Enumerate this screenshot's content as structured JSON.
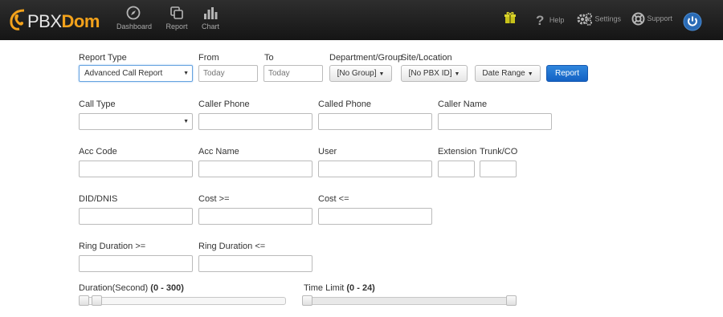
{
  "brand": {
    "logo_prefix": "PBX",
    "logo_suffix": "Dom",
    "accent": "#f3a21b"
  },
  "nav": {
    "items": [
      {
        "label": "Dashboard",
        "icon": "compass-icon"
      },
      {
        "label": "Report",
        "icon": "copy-icon"
      },
      {
        "label": "Chart",
        "icon": "bar-chart-icon"
      }
    ],
    "right": {
      "help": "Help",
      "settings": "Settings",
      "support": "Support"
    }
  },
  "form": {
    "report_type": {
      "label": "Report Type",
      "value": "Advanced Call Report"
    },
    "from": {
      "label": "From",
      "placeholder": "Today"
    },
    "to": {
      "label": "To",
      "placeholder": "Today"
    },
    "department": {
      "label": "Department/Group",
      "value": "[No Group]"
    },
    "site": {
      "label": "Site/Location",
      "value": "[No PBX ID]"
    },
    "date_range": {
      "label": "Date Range"
    },
    "report_button": "Report",
    "call_type": {
      "label": "Call Type",
      "value": ""
    },
    "caller_phone": "Caller Phone",
    "called_phone": "Called Phone",
    "caller_name": "Caller Name",
    "acc_code": "Acc Code",
    "acc_name": "Acc Name",
    "user": "User",
    "extension": "Extension",
    "trunk_co": "Trunk/CO",
    "did_dnis": "DID/DNIS",
    "cost_gte": "Cost >=",
    "cost_lte": "Cost <=",
    "ring_gte": "Ring Duration >=",
    "ring_lte": "Ring Duration <=",
    "duration": {
      "label": "Duration(Second)",
      "range": "(0 - 300)",
      "min_value": 0,
      "max_value": 20,
      "scale_max": 300
    },
    "time_limit": {
      "label": "Time Limit",
      "range": "(0 - 24)",
      "min_value": 0,
      "max_value": 24,
      "scale_max": 24
    }
  }
}
